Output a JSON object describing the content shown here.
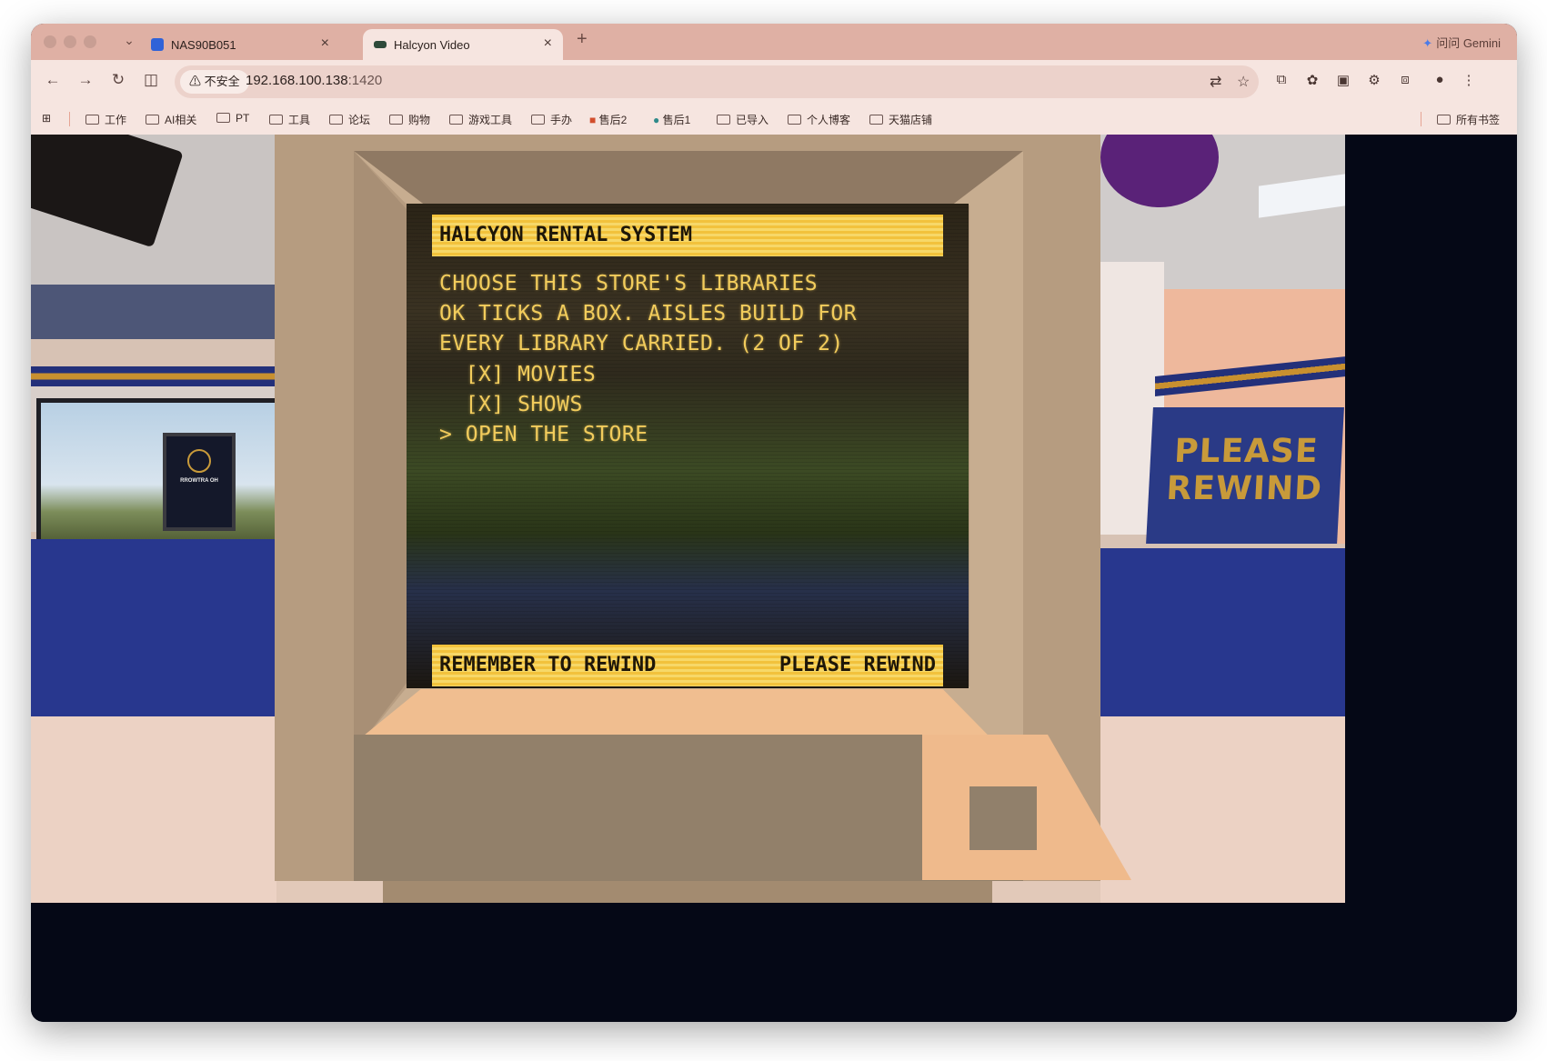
{
  "browser": {
    "tabs": [
      {
        "label": "NAS90B051",
        "icon": "nas-app-icon",
        "active": false
      },
      {
        "label": "Halcyon Video",
        "icon": "video-site-icon",
        "active": true
      }
    ],
    "gemini_label": "问问 Gemini",
    "security_label": "不安全",
    "url_host": "192.168.100.138",
    "url_port": ":1420",
    "bookmarks": [
      "工作",
      "AI相关",
      "PT",
      "工具",
      "论坛",
      "购物",
      "游戏工具",
      "手办",
      "售后2",
      "售后1",
      "已导入",
      "个人博客",
      "天猫店铺"
    ],
    "all_bookmarks_label": "所有书签",
    "accent": "#dfb0a4"
  },
  "game": {
    "header": "HALCYON RENTAL SYSTEM",
    "lines": [
      "CHOOSE THIS STORE'S LIBRARIES",
      "OK TICKS A BOX. AISLES BUILD FOR",
      "EVERY LIBRARY CARRIED. (2 OF 2)",
      "  [X] MOVIES",
      "  [X] SHOWS",
      "> OPEN THE STORE"
    ],
    "footer_left": "REMEMBER TO REWIND",
    "footer_right": "PLEASE REWIND",
    "sign_line1": "PLEASE",
    "sign_line2": "REWIND",
    "poster_text": "RROWTRA OH",
    "screen_text_color": "#f2cc5c",
    "bar_color": "#f2c23c"
  }
}
